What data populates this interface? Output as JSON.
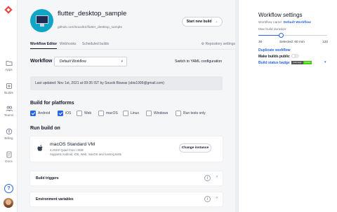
{
  "nav": {
    "items": [
      {
        "label": "Apps",
        "icon": "folder-icon"
      },
      {
        "label": "Builds",
        "icon": "build-icon"
      },
      {
        "label": "Teams",
        "icon": "teams-icon"
      },
      {
        "label": "Billing",
        "icon": "billing-icon"
      },
      {
        "label": "Docs",
        "icon": "docs-icon"
      }
    ],
    "help": "?"
  },
  "app": {
    "title": "flutter_desktop_sample",
    "repo": "github.com/souvik1/flutter_desktop_sample",
    "start_build": "Start new build",
    "start_build_arrow": "→"
  },
  "tabs": {
    "items": [
      "Workflow Editor",
      "Webhooks",
      "Scheduled builds"
    ],
    "repo_settings": "Repository settings"
  },
  "workflow": {
    "label": "Workflow",
    "selected": "Default Workflow",
    "switch_yaml": "Switch to YAML configuration"
  },
  "last_updated": "Last updated: Nov 1st, 2021 at 09:35 IST by Souvik Biswas (sbis1999@gmail.com)",
  "build_for": {
    "title": "Build for platforms",
    "platforms": [
      {
        "label": "Android",
        "checked": true
      },
      {
        "label": "iOS",
        "checked": true
      },
      {
        "label": "Web",
        "checked": false
      },
      {
        "label": "macOS",
        "checked": false
      },
      {
        "label": "Linux",
        "checked": false
      },
      {
        "label": "Windows",
        "checked": false
      },
      {
        "label": "Run tests only",
        "checked": false
      }
    ]
  },
  "run_on": {
    "title": "Run build on",
    "vm_name": "macOS Standard VM",
    "vm_spec": "3.2GHz Quad Core / 8GB",
    "vm_supports": "Supports Android, iOS, Web, macOS and running tests",
    "change": "Change instance"
  },
  "sections": [
    {
      "title": "Build triggers",
      "info": "i",
      "chevron": "›"
    },
    {
      "title": "Environment variables",
      "info": "i",
      "chevron": "›"
    }
  ],
  "settings": {
    "title": "Workflow settings",
    "workflow_name_label": "Workflow name:",
    "workflow_name_value": "Default Workflow",
    "max_duration_label": "Max build duration:",
    "min": "30",
    "selected": "Selected: 60 min",
    "max": "120",
    "duration_value": 60,
    "duration_min": 30,
    "duration_max": 120,
    "duplicate": "Duplicate workflow",
    "make_public": "Make builds public",
    "badge_label": "Build status badge",
    "badge_left": "codemagic",
    "badge_right": "passed",
    "badge_chevron": "▾"
  },
  "colors": {
    "accent": "#2563eb",
    "logo": "#e8473f"
  }
}
